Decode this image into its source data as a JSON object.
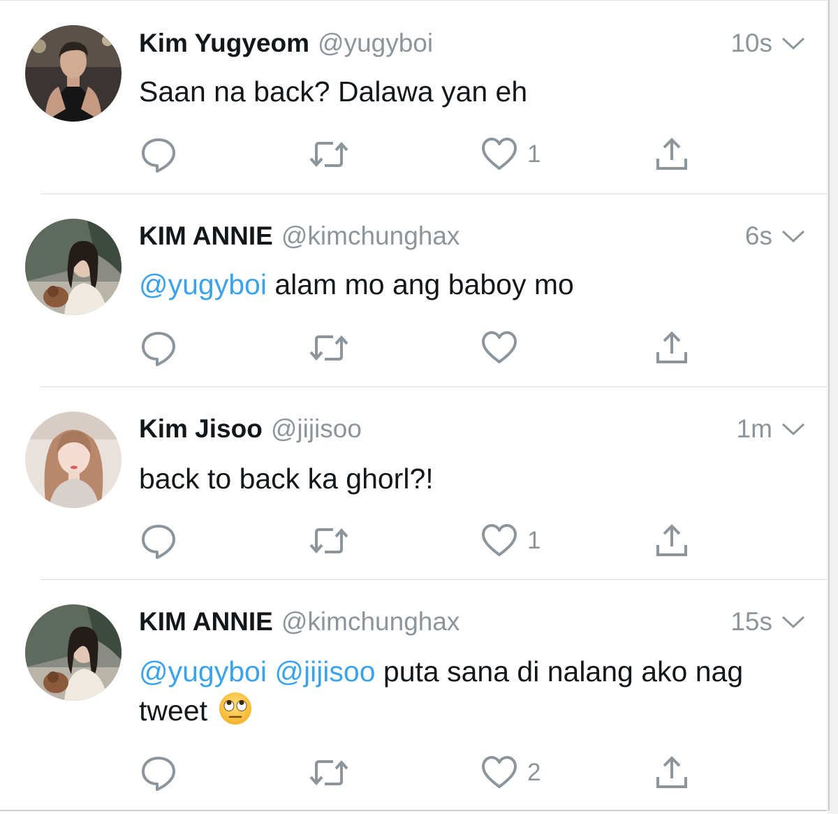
{
  "tweets": [
    {
      "name": "Kim Yugyeom",
      "handle": "@yugyboi",
      "time": "10s",
      "text_parts": [
        {
          "text": "Saan na back? Dalawa yan eh",
          "mention": false
        }
      ],
      "emoji": null,
      "likes": "1",
      "avatar": "portrait-man-black-tank-top"
    },
    {
      "name": "KIM ANNIE",
      "handle": "@kimchunghax",
      "time": "6s",
      "text_parts": [
        {
          "text": "@yugyboi",
          "mention": true
        },
        {
          "text": " alam mo ang baboy mo",
          "mention": false
        }
      ],
      "emoji": null,
      "likes": "",
      "avatar": "portrait-woman-with-dog"
    },
    {
      "name": "Kim Jisoo",
      "handle": "@jijisoo",
      "time": "1m",
      "text_parts": [
        {
          "text": "back to back ka ghorl?!",
          "mention": false
        }
      ],
      "emoji": null,
      "likes": "1",
      "avatar": "portrait-woman-long-hair"
    },
    {
      "name": "KIM ANNIE",
      "handle": "@kimchunghax",
      "time": "15s",
      "text_parts": [
        {
          "text": "@yugyboi",
          "mention": true
        },
        {
          "text": " ",
          "mention": false
        },
        {
          "text": "@jijisoo",
          "mention": true
        },
        {
          "text": " puta sana di nalang ako nag tweet",
          "mention": false
        }
      ],
      "emoji": "face-with-rolling-eyes",
      "likes": "2",
      "avatar": "portrait-woman-with-dog"
    }
  ],
  "icons": {
    "reply": "reply-icon",
    "retweet": "retweet-icon",
    "like": "heart-icon",
    "share": "share-icon",
    "menu": "chevron-down-icon"
  },
  "colors": {
    "mention": "#3aa3ec",
    "secondary_text": "#8c959c",
    "icon": "#8c959c",
    "divider": "#d9dde0"
  }
}
